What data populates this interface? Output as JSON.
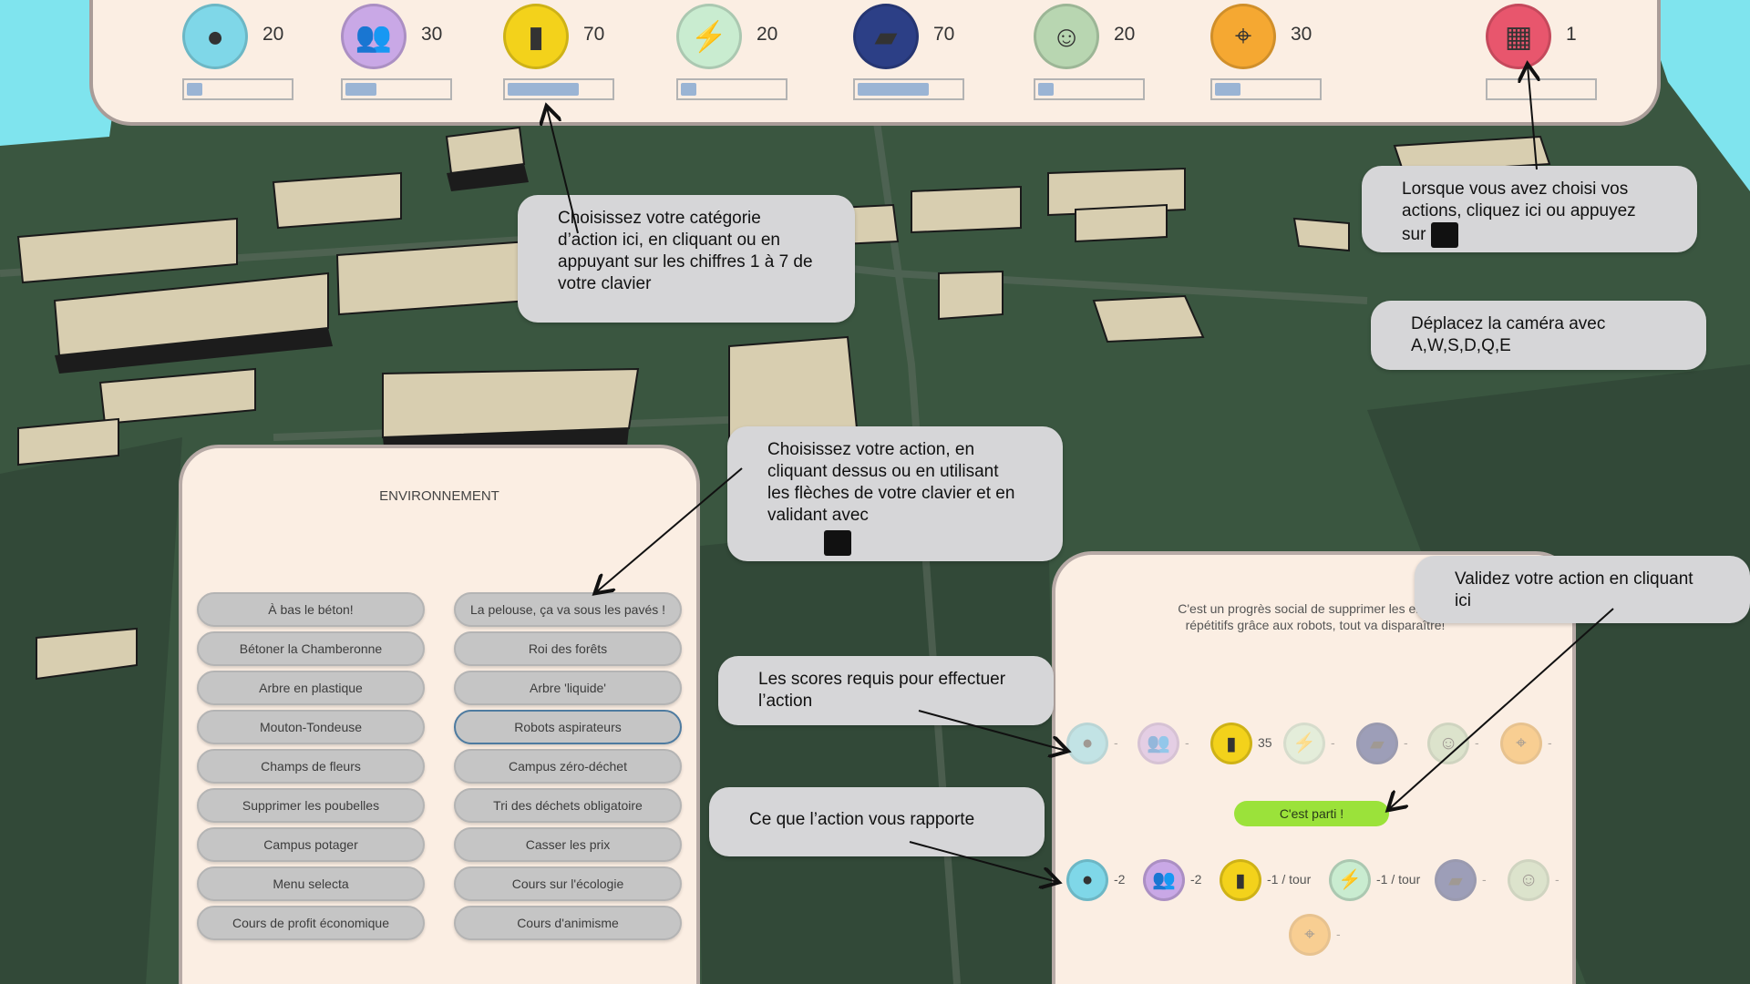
{
  "resources": [
    {
      "icon": "planet-icon",
      "value": "20",
      "fill": 0.15,
      "color": "#7fd7e8"
    },
    {
      "icon": "people-icon",
      "value": "30",
      "fill": 0.3,
      "color": "#c9a8e6"
    },
    {
      "icon": "coin-icon",
      "value": "70",
      "fill": 0.7,
      "color": "#f3d21b"
    },
    {
      "icon": "energy-icon",
      "value": "20",
      "fill": 0.15,
      "color": "#c9ecd0"
    },
    {
      "icon": "education-icon",
      "value": "70",
      "fill": 0.7,
      "color": "#2c3f86"
    },
    {
      "icon": "culture-masks-icon",
      "value": "20",
      "fill": 0.15,
      "color": "#b8d6b1"
    },
    {
      "icon": "travel-map-icon",
      "value": "30",
      "fill": 0.25,
      "color": "#f5a832"
    },
    {
      "icon": "next-calendar-icon",
      "value": "1",
      "fill": 0.0,
      "color": "#e8566d"
    }
  ],
  "category": {
    "title": "ENVIRONNEMENT",
    "actions_left": [
      "À bas le béton!",
      "Bétoner la Chamberonne",
      "Arbre en plastique",
      "Mouton-Tondeuse",
      "Champs de fleurs",
      "Supprimer les poubelles",
      "Campus potager",
      "Menu selecta",
      "Cours de profit économique"
    ],
    "actions_right": [
      "La pelouse, ça va sous les pavés !",
      "Roi des forêts",
      "Arbre 'liquide'",
      "Robots aspirateurs",
      "Campus zéro-déchet",
      "Tri des déchets obligatoire",
      "Casser les prix",
      "Cours sur l'écologie",
      "Cours d'animisme"
    ],
    "selected": "Robots aspirateurs"
  },
  "detail": {
    "description": "C'est un progrès social de supprimer les emplois répétitifs grâce aux robots, tout va disparaître!",
    "required": [
      {
        "icon": "planet-icon",
        "value": "-"
      },
      {
        "icon": "people-icon",
        "value": "-"
      },
      {
        "icon": "coin-icon",
        "value": "35"
      },
      {
        "icon": "energy-icon",
        "value": "-"
      },
      {
        "icon": "education-icon",
        "value": "-"
      },
      {
        "icon": "culture-masks-icon",
        "value": "-"
      },
      {
        "icon": "travel-map-icon",
        "value": "-"
      }
    ],
    "go_label": "C'est parti !",
    "rewards": [
      {
        "icon": "planet-icon",
        "value": "-2"
      },
      {
        "icon": "people-icon",
        "value": "-2"
      },
      {
        "icon": "coin-icon",
        "value": "-1 / tour"
      },
      {
        "icon": "energy-icon",
        "value": "-1 / tour"
      },
      {
        "icon": "education-icon",
        "value": "-"
      },
      {
        "icon": "culture-masks-icon",
        "value": "-"
      },
      {
        "icon": "travel-map-icon",
        "value": "-"
      }
    ]
  },
  "tooltips": {
    "category": "Choisissez votre catégorie d’action ici, en cliquant ou en appuyant sur les chiffres 1 à 7 de votre clavier",
    "next": "Lorsque vous avez choisi vos actions, cliquez ici ou appuyez sur",
    "camera": "Déplacez la caméra avec A,W,S,D,Q,E",
    "action": "Choisissez votre action, en cliquant dessus ou en utilisant les flèches de votre clavier et en validant avec",
    "validate": "Validez votre action en cliquant ici",
    "required": "Les scores requis pour effectuer l’action",
    "reward": "Ce que l’action vous rapporte"
  },
  "colors": {
    "panel": "#fbeee3",
    "button": "#c5c5c5",
    "go": "#9be23a",
    "tooltip": "#d6d6d8",
    "grass": "#3c5a42",
    "sky": "#7fe4ee",
    "building": "#d8ceb0"
  }
}
